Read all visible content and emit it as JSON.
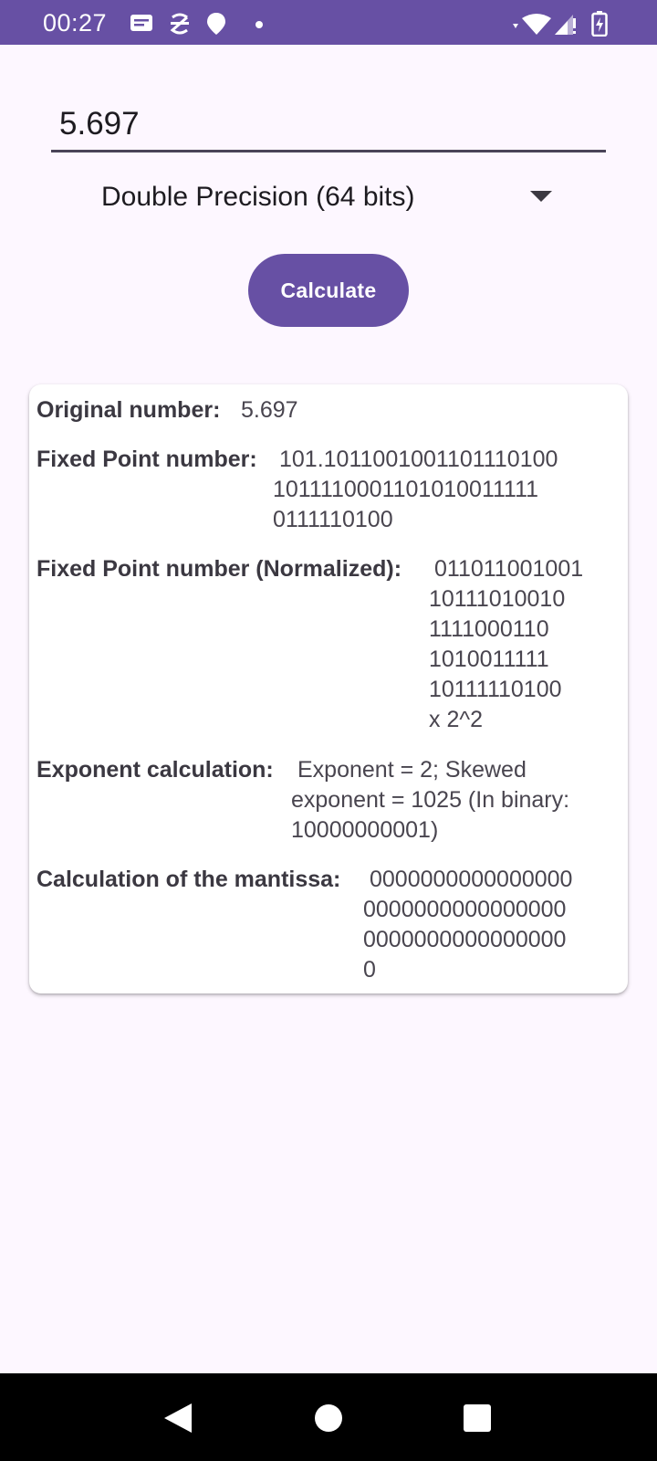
{
  "status_bar": {
    "time": "00:27",
    "icons": [
      "message-icon",
      "s-icon",
      "location-icon",
      "dot-icon",
      "wifi-icon",
      "signal-icon",
      "battery-icon"
    ]
  },
  "input": {
    "value": "5.697"
  },
  "precision_dropdown": {
    "selected": "Double Precision (64 bits)"
  },
  "calculate_button": {
    "label": "Calculate"
  },
  "results": {
    "original": {
      "label": "Original number:",
      "value": "5.697"
    },
    "fixed_point": {
      "label": "Fixed Point number:",
      "value": "101.10110010011011101001011110001101010011111\n0111110100",
      "lines": [
        "101.1011001001101110100",
        "1011110001101010011111",
        "0111110100"
      ]
    },
    "normalized": {
      "label": "Fixed Point number (Normalized):",
      "lines": [
        "011011001001",
        "10111010010",
        "1111000110",
        "1010011111",
        "10111110100",
        "x 2^2"
      ]
    },
    "exponent": {
      "label": "Exponent calculation:",
      "lines": [
        "Exponent = 2; Skewed",
        "exponent = 1025 (In binary:",
        "10000000001)"
      ]
    },
    "mantissa": {
      "label": "Calculation of the mantissa:",
      "lines": [
        "0000000000000000",
        "0000000000000000",
        "0000000000000000",
        "0"
      ]
    }
  },
  "colors": {
    "primary": "#6750A4",
    "background": "#FDF7FF",
    "card": "#FFFFFF",
    "text": "#49454F"
  }
}
